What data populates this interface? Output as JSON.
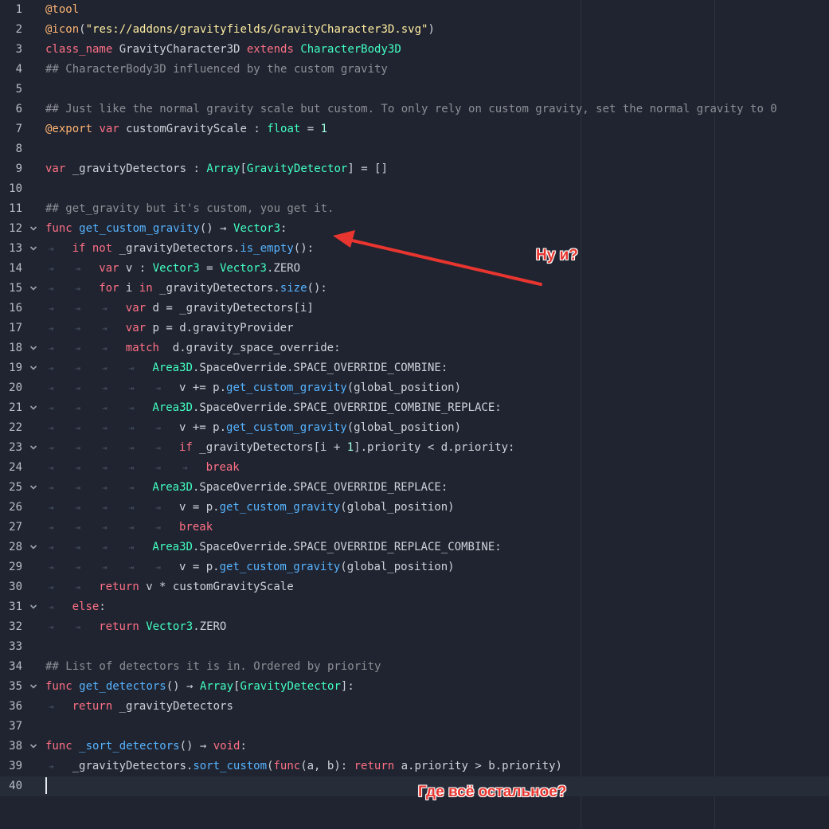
{
  "editor": {
    "lines": [
      {
        "n": "1",
        "fold": false,
        "indent": 0,
        "tokens": [
          [
            "an",
            "@tool"
          ]
        ]
      },
      {
        "n": "2",
        "fold": false,
        "indent": 0,
        "tokens": [
          [
            "an",
            "@icon"
          ],
          [
            "id",
            "("
          ],
          [
            "str",
            "\"res://addons/gravityfields/GravityCharacter3D.svg\""
          ],
          [
            "id",
            ")"
          ]
        ]
      },
      {
        "n": "3",
        "fold": false,
        "indent": 0,
        "tokens": [
          [
            "kw",
            "class_name"
          ],
          [
            "id",
            " GravityCharacter3D "
          ],
          [
            "kw",
            "extends"
          ],
          [
            "id",
            " "
          ],
          [
            "ty",
            "CharacterBody3D"
          ]
        ]
      },
      {
        "n": "4",
        "fold": false,
        "indent": 0,
        "tokens": [
          [
            "cm",
            "## CharacterBody3D influenced by the custom gravity"
          ]
        ]
      },
      {
        "n": "5",
        "fold": false,
        "indent": 0,
        "tokens": []
      },
      {
        "n": "6",
        "fold": false,
        "indent": 0,
        "tokens": [
          [
            "cm",
            "## Just like the normal gravity scale but custom. To only rely on custom gravity, set the normal gravity to 0"
          ]
        ]
      },
      {
        "n": "7",
        "fold": false,
        "indent": 0,
        "tokens": [
          [
            "an",
            "@export"
          ],
          [
            "id",
            " "
          ],
          [
            "kw",
            "var"
          ],
          [
            "id",
            " customGravityScale : "
          ],
          [
            "ty",
            "float"
          ],
          [
            "id",
            " = "
          ],
          [
            "nm",
            "1"
          ]
        ]
      },
      {
        "n": "8",
        "fold": false,
        "indent": 0,
        "tokens": []
      },
      {
        "n": "9",
        "fold": false,
        "indent": 0,
        "tokens": [
          [
            "kw",
            "var"
          ],
          [
            "id",
            " _gravityDetectors : "
          ],
          [
            "ty",
            "Array"
          ],
          [
            "id",
            "["
          ],
          [
            "ty",
            "GravityDetector"
          ],
          [
            "id",
            "] = []"
          ]
        ]
      },
      {
        "n": "10",
        "fold": false,
        "indent": 0,
        "tokens": []
      },
      {
        "n": "11",
        "fold": false,
        "indent": 0,
        "tokens": [
          [
            "cm",
            "## get_gravity but it's custom, you get it."
          ]
        ]
      },
      {
        "n": "12",
        "fold": true,
        "indent": 0,
        "tokens": [
          [
            "kw",
            "func"
          ],
          [
            "id",
            " "
          ],
          [
            "fn",
            "get_custom_gravity"
          ],
          [
            "id",
            "() → "
          ],
          [
            "ty",
            "Vector3"
          ],
          [
            "id",
            ":"
          ]
        ]
      },
      {
        "n": "13",
        "fold": true,
        "indent": 1,
        "tokens": [
          [
            "kw",
            "if not"
          ],
          [
            "id",
            " _gravityDetectors."
          ],
          [
            "fn",
            "is_empty"
          ],
          [
            "id",
            "():"
          ]
        ]
      },
      {
        "n": "14",
        "fold": false,
        "indent": 2,
        "tokens": [
          [
            "kw",
            "var"
          ],
          [
            "id",
            " v : "
          ],
          [
            "ty",
            "Vector3"
          ],
          [
            "id",
            " = "
          ],
          [
            "ty",
            "Vector3"
          ],
          [
            "id",
            ".ZERO"
          ]
        ]
      },
      {
        "n": "15",
        "fold": true,
        "indent": 2,
        "tokens": [
          [
            "kw",
            "for"
          ],
          [
            "id",
            " i "
          ],
          [
            "kw",
            "in"
          ],
          [
            "id",
            " _gravityDetectors."
          ],
          [
            "fn",
            "size"
          ],
          [
            "id",
            "():"
          ]
        ]
      },
      {
        "n": "16",
        "fold": false,
        "indent": 3,
        "tokens": [
          [
            "kw",
            "var"
          ],
          [
            "id",
            " d = _gravityDetectors[i]"
          ]
        ]
      },
      {
        "n": "17",
        "fold": false,
        "indent": 3,
        "tokens": [
          [
            "kw",
            "var"
          ],
          [
            "id",
            " p = d.gravityProvider"
          ]
        ]
      },
      {
        "n": "18",
        "fold": true,
        "indent": 3,
        "tokens": [
          [
            "kw",
            "match"
          ],
          [
            "id",
            "  d.gravity_space_override:"
          ]
        ]
      },
      {
        "n": "19",
        "fold": true,
        "indent": 4,
        "tokens": [
          [
            "ty",
            "Area3D"
          ],
          [
            "id",
            ".SpaceOverride.SPACE_OVERRIDE_COMBINE:"
          ]
        ]
      },
      {
        "n": "20",
        "fold": false,
        "indent": 5,
        "tokens": [
          [
            "id",
            "v += p."
          ],
          [
            "fn",
            "get_custom_gravity"
          ],
          [
            "id",
            "(global_position)"
          ]
        ]
      },
      {
        "n": "21",
        "fold": true,
        "indent": 4,
        "tokens": [
          [
            "ty",
            "Area3D"
          ],
          [
            "id",
            ".SpaceOverride.SPACE_OVERRIDE_COMBINE_REPLACE:"
          ]
        ]
      },
      {
        "n": "22",
        "fold": false,
        "indent": 5,
        "tokens": [
          [
            "id",
            "v += p."
          ],
          [
            "fn",
            "get_custom_gravity"
          ],
          [
            "id",
            "(global_position)"
          ]
        ]
      },
      {
        "n": "23",
        "fold": true,
        "indent": 5,
        "tokens": [
          [
            "kw",
            "if"
          ],
          [
            "id",
            " _gravityDetectors[i + "
          ],
          [
            "nm",
            "1"
          ],
          [
            "id",
            "].priority < d.priority:"
          ]
        ]
      },
      {
        "n": "24",
        "fold": false,
        "indent": 6,
        "tokens": [
          [
            "kw",
            "break"
          ]
        ]
      },
      {
        "n": "25",
        "fold": true,
        "indent": 4,
        "tokens": [
          [
            "ty",
            "Area3D"
          ],
          [
            "id",
            ".SpaceOverride.SPACE_OVERRIDE_REPLACE:"
          ]
        ]
      },
      {
        "n": "26",
        "fold": false,
        "indent": 5,
        "tokens": [
          [
            "id",
            "v = p."
          ],
          [
            "fn",
            "get_custom_gravity"
          ],
          [
            "id",
            "(global_position)"
          ]
        ]
      },
      {
        "n": "27",
        "fold": false,
        "indent": 5,
        "tokens": [
          [
            "kw",
            "break"
          ]
        ]
      },
      {
        "n": "28",
        "fold": true,
        "indent": 4,
        "tokens": [
          [
            "ty",
            "Area3D"
          ],
          [
            "id",
            ".SpaceOverride.SPACE_OVERRIDE_REPLACE_COMBINE:"
          ]
        ]
      },
      {
        "n": "29",
        "fold": false,
        "indent": 5,
        "tokens": [
          [
            "id",
            "v = p."
          ],
          [
            "fn",
            "get_custom_gravity"
          ],
          [
            "id",
            "(global_position)"
          ]
        ]
      },
      {
        "n": "30",
        "fold": false,
        "indent": 2,
        "tokens": [
          [
            "kw",
            "return"
          ],
          [
            "id",
            " v * customGravityScale"
          ]
        ]
      },
      {
        "n": "31",
        "fold": true,
        "indent": 1,
        "tokens": [
          [
            "kw",
            "else"
          ],
          [
            "id",
            ":"
          ]
        ]
      },
      {
        "n": "32",
        "fold": false,
        "indent": 2,
        "tokens": [
          [
            "kw",
            "return"
          ],
          [
            "id",
            " "
          ],
          [
            "ty",
            "Vector3"
          ],
          [
            "id",
            ".ZERO"
          ]
        ]
      },
      {
        "n": "33",
        "fold": false,
        "indent": 0,
        "tokens": []
      },
      {
        "n": "34",
        "fold": false,
        "indent": 0,
        "tokens": [
          [
            "cm",
            "## List of detectors it is in. Ordered by priority"
          ]
        ]
      },
      {
        "n": "35",
        "fold": true,
        "indent": 0,
        "tokens": [
          [
            "kw",
            "func"
          ],
          [
            "id",
            " "
          ],
          [
            "fn",
            "get_detectors"
          ],
          [
            "id",
            "() → "
          ],
          [
            "ty",
            "Array"
          ],
          [
            "id",
            "["
          ],
          [
            "ty",
            "GravityDetector"
          ],
          [
            "id",
            "]:"
          ]
        ]
      },
      {
        "n": "36",
        "fold": false,
        "indent": 1,
        "tokens": [
          [
            "kw",
            "return"
          ],
          [
            "id",
            " _gravityDetectors"
          ]
        ]
      },
      {
        "n": "37",
        "fold": false,
        "indent": 0,
        "tokens": []
      },
      {
        "n": "38",
        "fold": true,
        "indent": 0,
        "tokens": [
          [
            "kw",
            "func"
          ],
          [
            "id",
            " "
          ],
          [
            "fn",
            "_sort_detectors"
          ],
          [
            "id",
            "() → "
          ],
          [
            "kw",
            "void"
          ],
          [
            "id",
            ":"
          ]
        ]
      },
      {
        "n": "39",
        "fold": false,
        "indent": 1,
        "tokens": [
          [
            "id",
            "_gravityDetectors."
          ],
          [
            "fn",
            "sort_custom"
          ],
          [
            "id",
            "("
          ],
          [
            "kw",
            "func"
          ],
          [
            "id",
            "(a, b): "
          ],
          [
            "kw",
            "return"
          ],
          [
            "id",
            " a.priority > b.priority)"
          ]
        ]
      },
      {
        "n": "40",
        "fold": false,
        "indent": 0,
        "tokens": []
      }
    ],
    "current_line": "40",
    "tab_glyph": "⇥"
  },
  "annotations": {
    "note_top": "Ну и?",
    "note_bottom": "Где всё остальное?",
    "color": "#e8352f"
  },
  "colors": {
    "background": "#1f2430",
    "keyword": "#ff7085",
    "function": "#57b3ff",
    "type": "#42ffc2",
    "annotation": "#ffb373",
    "string": "#ffeda1"
  }
}
